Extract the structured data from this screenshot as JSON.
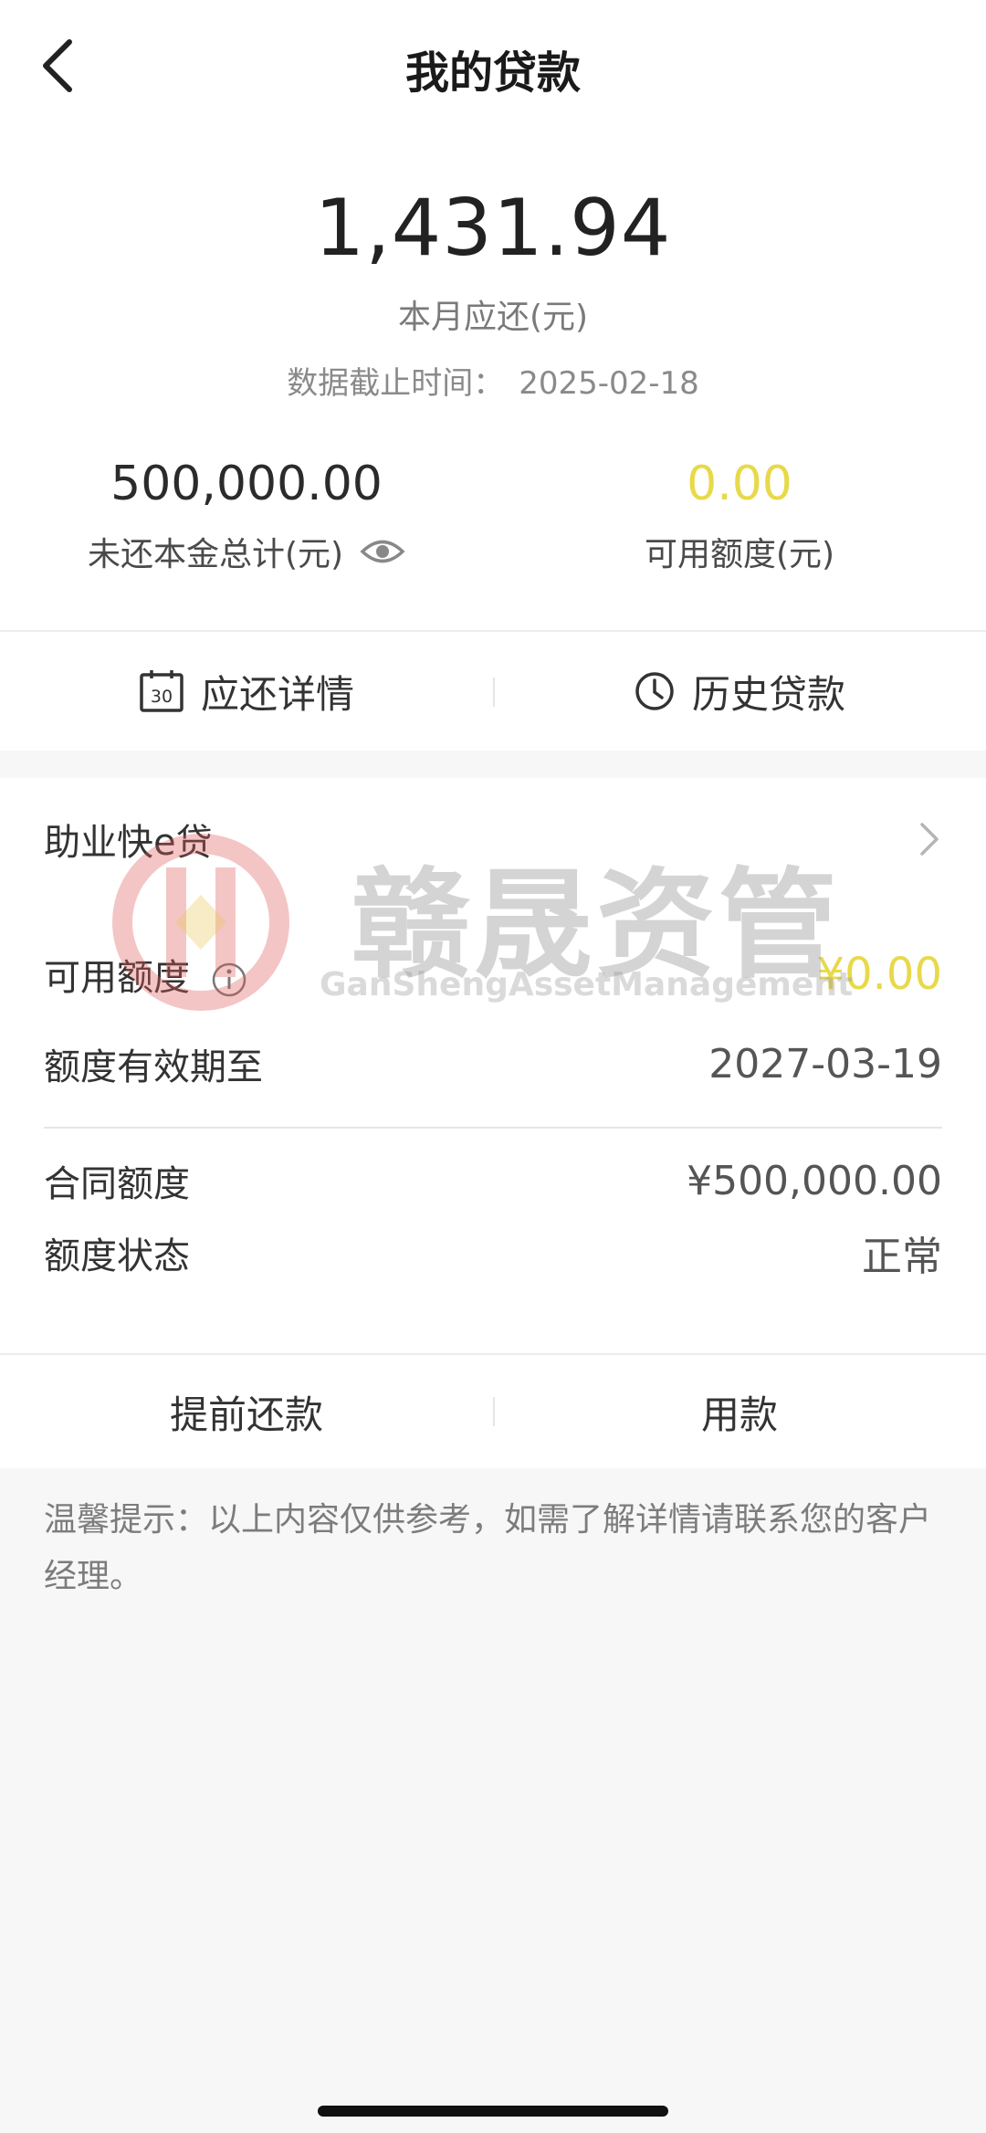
{
  "header": {
    "title": "我的贷款",
    "back_icon": "chevron-left-icon"
  },
  "summary": {
    "monthly_amount": "1,431.94",
    "monthly_label": "本月应还(元)",
    "cutoff_label": "数据截止时间：",
    "cutoff_date": "2025-02-18"
  },
  "stats": {
    "principal_value": "500,000.00",
    "principal_label": "未还本金总计(元)",
    "available_value": "0.00",
    "available_label": "可用额度(元)"
  },
  "tabs": [
    {
      "label": "应还详情",
      "icon": "calendar-30-icon"
    },
    {
      "label": "历史贷款",
      "icon": "clock-icon"
    }
  ],
  "product": {
    "name": "助业快e贷",
    "available_label": "可用额度",
    "available_value": "¥0.00",
    "expiry_label": "额度有效期至",
    "expiry_value": "2027-03-19",
    "contract_label": "合同额度",
    "contract_value": "¥500,000.00",
    "status_label": "额度状态",
    "status_value": "正常"
  },
  "actions": {
    "prepay_label": "提前还款",
    "draw_label": "用款"
  },
  "tip": {
    "text": "温馨提示：以上内容仅供参考，如需了解详情请联系您的客户经理。"
  },
  "watermark": {
    "title": "赣晟资管",
    "subtitle": "GanShengAssetManagement"
  },
  "colors": {
    "highlight_yellow": "#e8d94a",
    "watermark_red": "#e05a5a"
  }
}
